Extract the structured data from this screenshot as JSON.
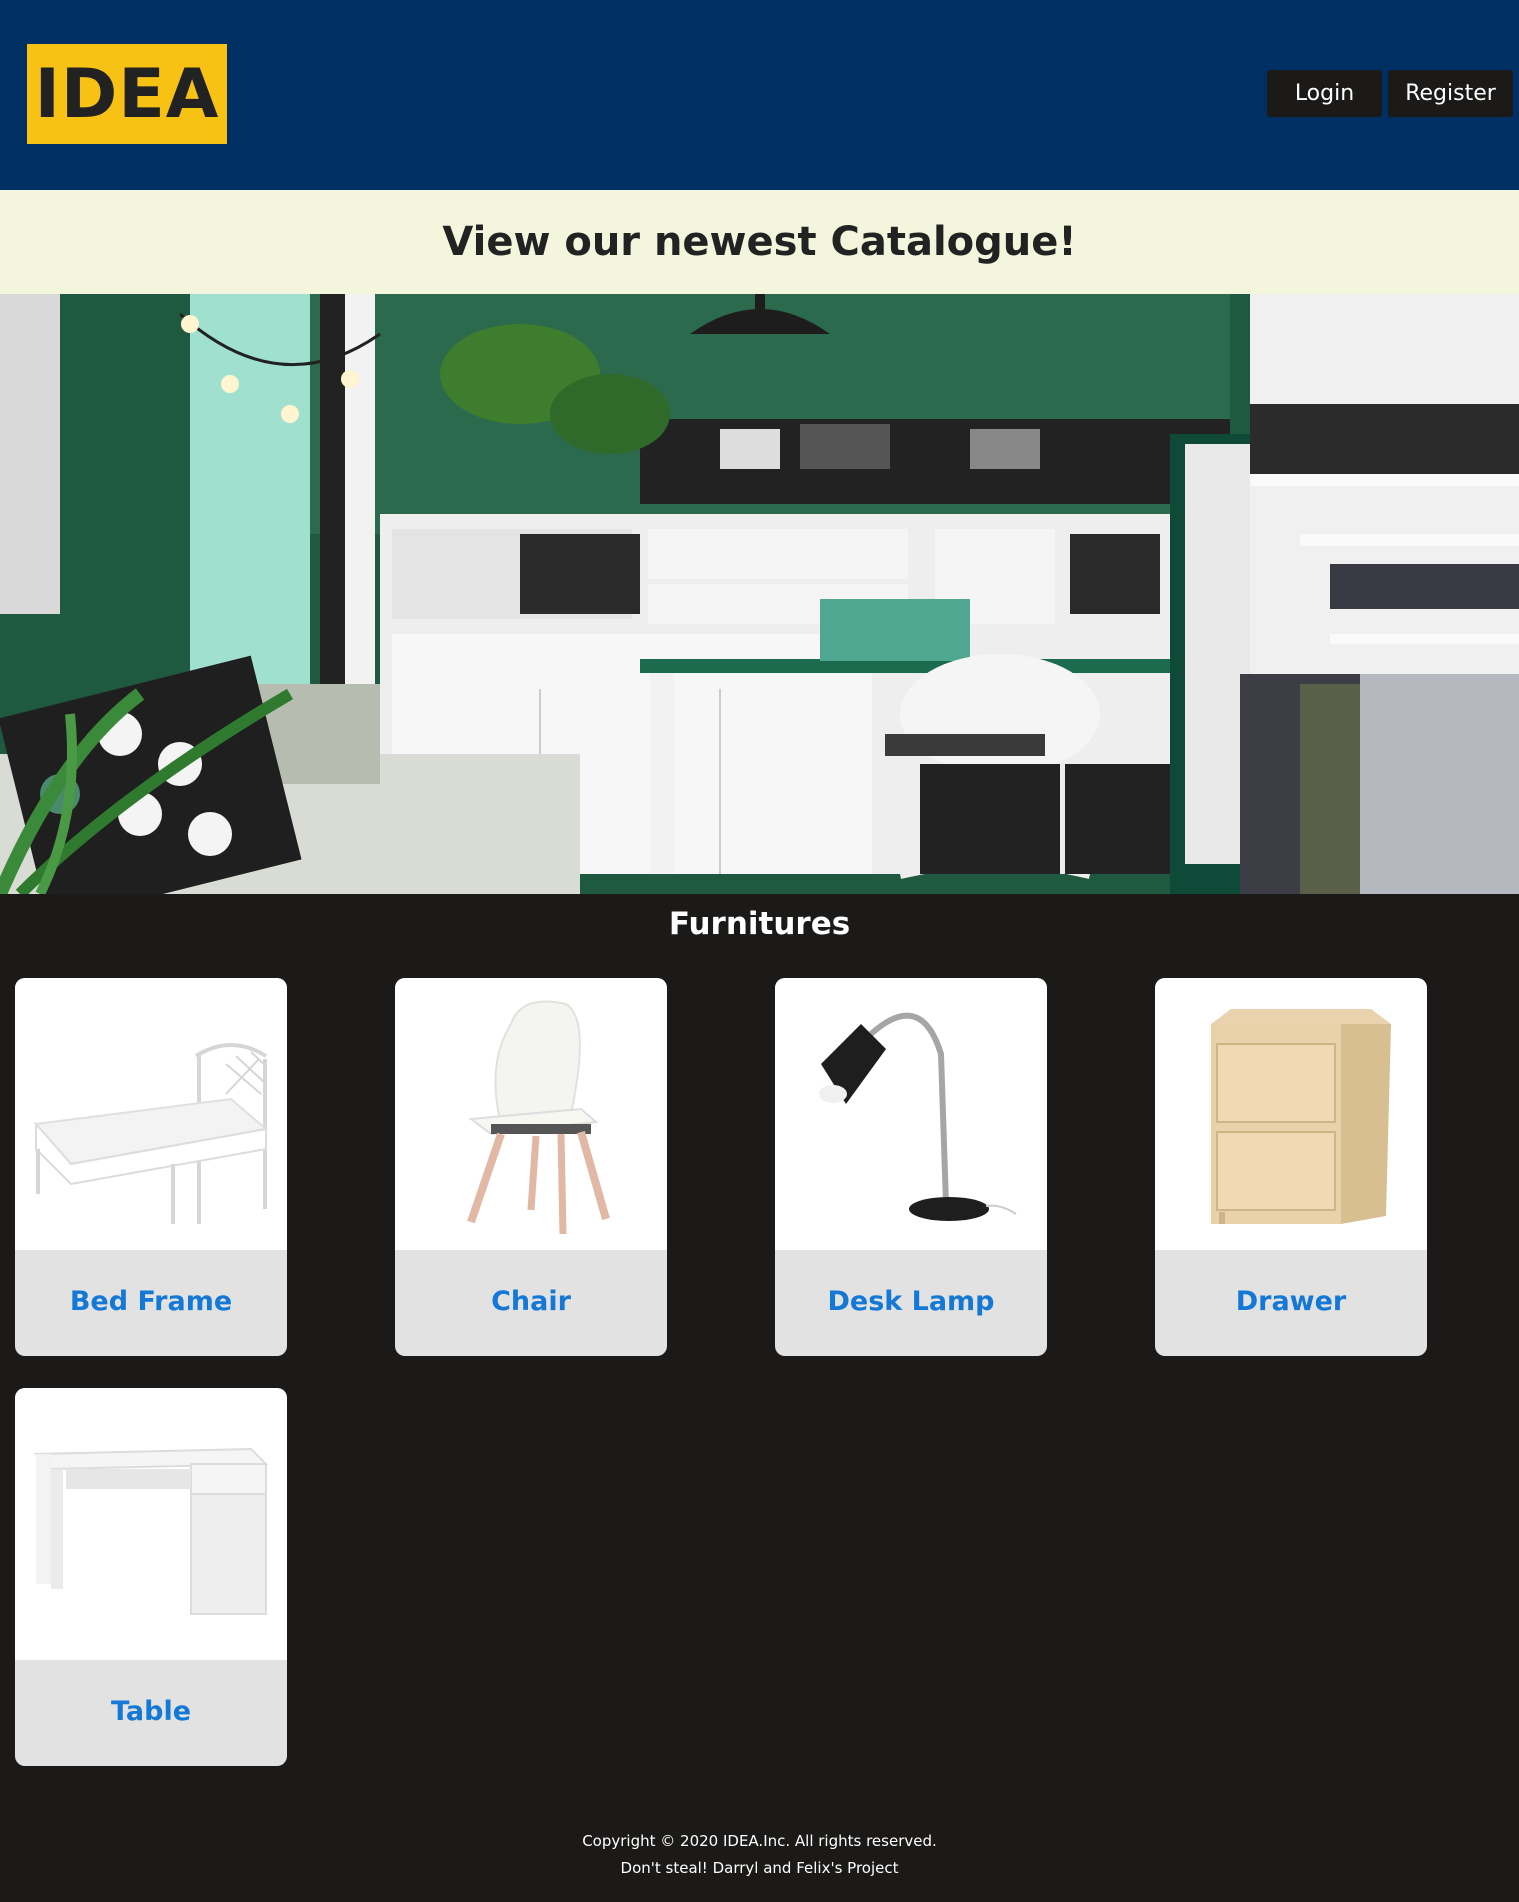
{
  "header": {
    "logo_text": "IDEA",
    "login_label": "Login",
    "register_label": "Register"
  },
  "banner": {
    "title": "View our newest Catalogue!"
  },
  "section": {
    "title": "Furnitures"
  },
  "products": [
    {
      "name": "Bed Frame",
      "icon": "bed-frame-image"
    },
    {
      "name": "Chair",
      "icon": "chair-image"
    },
    {
      "name": "Desk Lamp",
      "icon": "desk-lamp-image"
    },
    {
      "name": "Drawer",
      "icon": "drawer-image"
    },
    {
      "name": "Table",
      "icon": "table-image"
    }
  ],
  "footer": {
    "copyright": "Copyright © 2020 IDEA.Inc. All rights reserved.",
    "note": "Don't steal! Darryl and Felix's Project"
  },
  "colors": {
    "header_bg": "#003063",
    "logo_bg": "#f8c214",
    "banner_bg": "#f4f5dd",
    "page_bg": "#1b1a19",
    "link": "#1478d6"
  }
}
